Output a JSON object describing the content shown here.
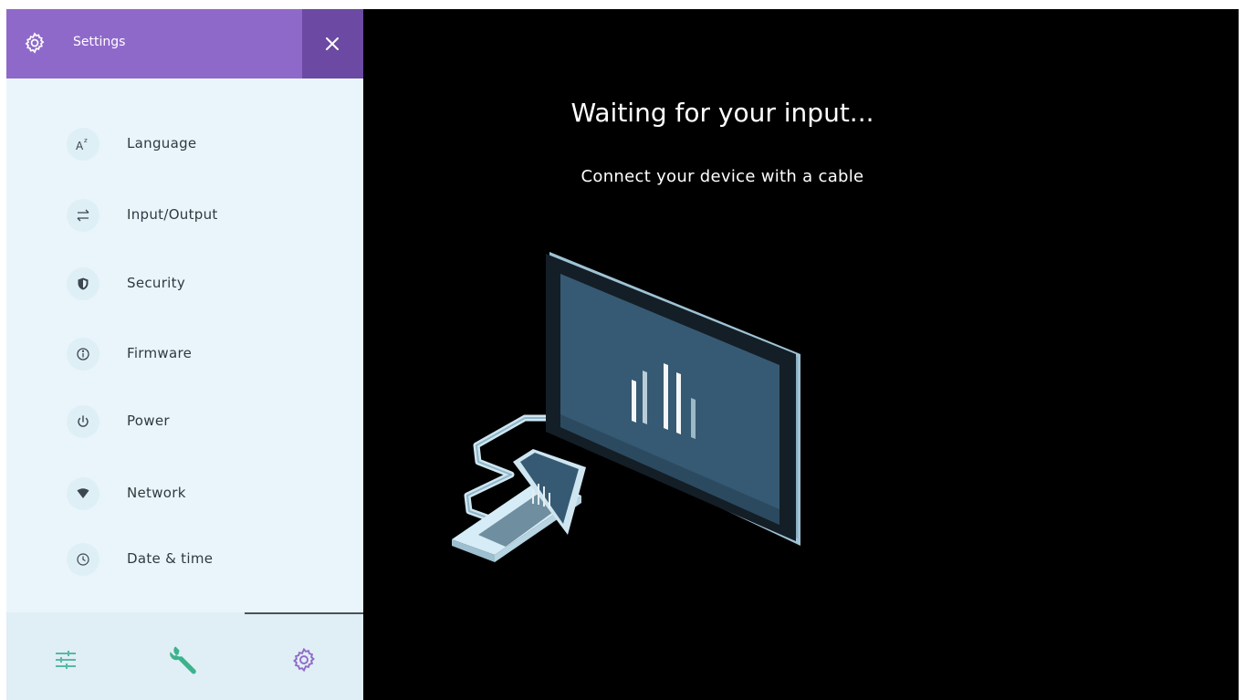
{
  "settings_panel": {
    "title": "Settings",
    "header_icon": "gear-icon",
    "close_icon": "close-icon",
    "menu": [
      {
        "label": "Language",
        "icon": "language-icon"
      },
      {
        "label": "Input/Output",
        "icon": "swap-arrows-icon"
      },
      {
        "label": "Security",
        "icon": "shield-icon"
      },
      {
        "label": "Firmware",
        "icon": "info-icon"
      },
      {
        "label": "Power",
        "icon": "power-icon"
      },
      {
        "label": "Network",
        "icon": "wifi-icon"
      },
      {
        "label": "Date & time",
        "icon": "clock-icon"
      }
    ],
    "tabs": [
      {
        "icon": "sliders-icon",
        "color": "#59b9a3"
      },
      {
        "icon": "wrench-icon",
        "color": "#3bb38d"
      },
      {
        "icon": "gear-icon",
        "color": "#8f69c9",
        "selected": true
      }
    ],
    "colors": {
      "header": "#8f69c9",
      "close_bg": "#6c4aa3",
      "panel_bg": "#e9f5fb"
    }
  },
  "main": {
    "heading": "Waiting for your input...",
    "subheading": "Connect your device with a cable",
    "illustration": "monitor-laptop-cable-illustration"
  }
}
